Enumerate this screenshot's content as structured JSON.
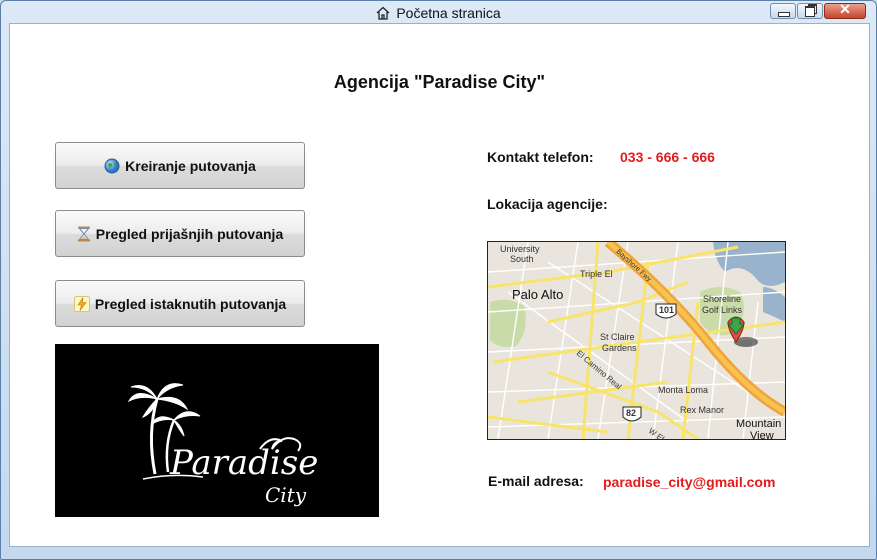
{
  "window": {
    "title": "Početna stranica"
  },
  "main": {
    "heading": "Agencija \"Paradise City\"",
    "buttons": [
      {
        "label": "Kreiranje putovanja",
        "icon": "globe-icon"
      },
      {
        "label": "Pregled prijašnjih putovanja",
        "icon": "hourglass-icon"
      },
      {
        "label": "Pregled istaknutih putovanja",
        "icon": "lightning-icon"
      }
    ],
    "logo": {
      "line1": "Paradise",
      "line2": "City"
    },
    "contact": {
      "phone_label": "Kontakt telefon:",
      "phone_value": "033 - 666 - 666",
      "location_label": "Lokacija agencije:",
      "email_label": "E-mail adresa:",
      "email_value": "paradise_city@gmail.com"
    },
    "map": {
      "labels": {
        "university": "University",
        "south": "South",
        "triple_el": "Triple El",
        "palo_alto": "Palo Alto",
        "bayshore": "Bayshore Fwy",
        "shoreline": "Shoreline",
        "golf_links": "Golf Links",
        "st_claire": "St Claire",
        "gardens": "Gardens",
        "el_camino": "El Camino Real",
        "monta_loma": "Monta Loma",
        "rex_manor": "Rex Manor",
        "mountain": "Mountain",
        "view": "View",
        "hwy101": "101",
        "hwy82": "82",
        "w_el": "W El"
      }
    }
  },
  "colors": {
    "accent": "#e31b1b",
    "window_frame": "#c9dcef"
  }
}
